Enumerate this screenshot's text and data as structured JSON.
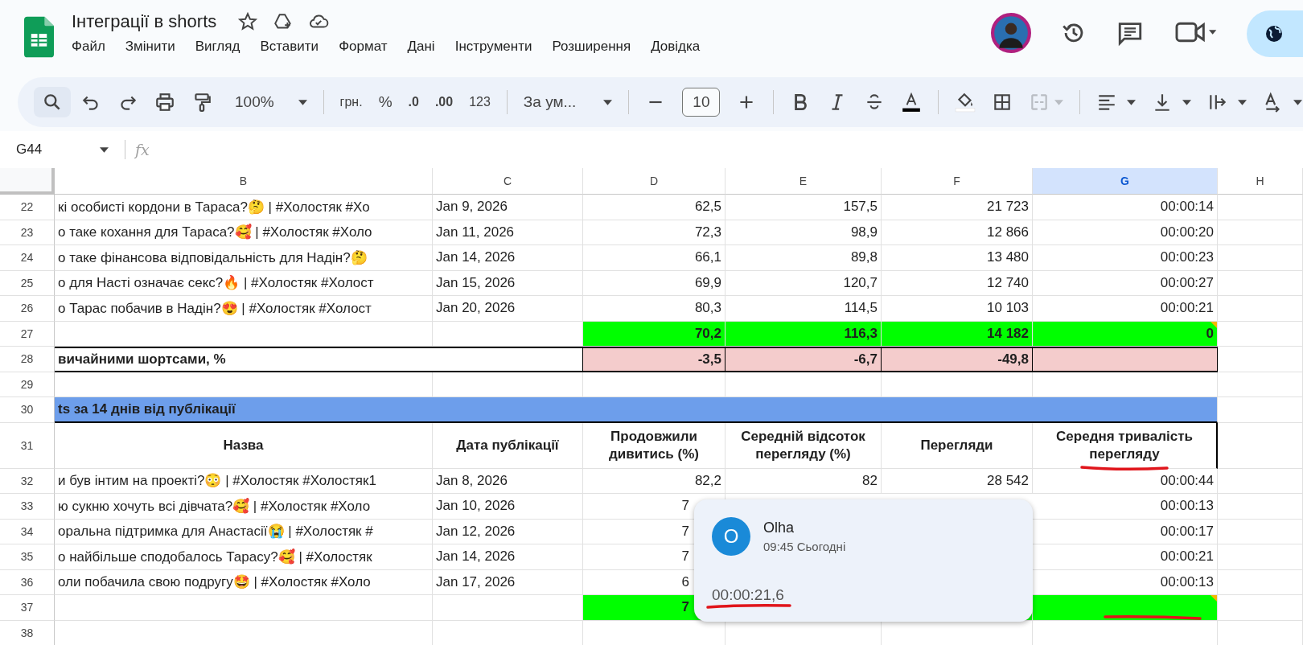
{
  "document": {
    "title": "Інтеграції в shorts"
  },
  "menu": [
    "Файл",
    "Змінити",
    "Вигляд",
    "Вставити",
    "Формат",
    "Дані",
    "Інструменти",
    "Розширення",
    "Довідка"
  ],
  "toolbar": {
    "zoom": "100%",
    "currency": "грн.",
    "percent": "%",
    "decrease_decimals": ".0",
    "increase_decimals": ".00",
    "number_format": "123",
    "font": "За ум...",
    "font_size": "10"
  },
  "name_box": "G44",
  "formula_label": "fx",
  "columns": [
    {
      "label": "B",
      "selected": false
    },
    {
      "label": "C",
      "selected": false
    },
    {
      "label": "D",
      "selected": false
    },
    {
      "label": "E",
      "selected": false
    },
    {
      "label": "F",
      "selected": false
    },
    {
      "label": "G",
      "selected": true
    },
    {
      "label": "H",
      "selected": false
    }
  ],
  "rows": [
    {
      "number": "22",
      "kind": "data",
      "covered": false,
      "title": "кі особисті кордони в Тараса?🤔 | #Холостяк #Хо",
      "date": "Jan 9, 2026",
      "values": [
        "62,5",
        "157,5",
        "21 723",
        "00:00:14"
      ]
    },
    {
      "number": "23",
      "kind": "data",
      "covered": false,
      "title": "о таке кохання для Тараса?🥰 | #Холостяк #Холо",
      "date": "Jan 11, 2026",
      "values": [
        "72,3",
        "98,9",
        "12 866",
        "00:00:20"
      ]
    },
    {
      "number": "24",
      "kind": "data",
      "covered": false,
      "title": "о таке фінансова відповідальність для Надін?🤔",
      "date": "Jan 14, 2026",
      "values": [
        "66,1",
        "89,8",
        "13 480",
        "00:00:23"
      ]
    },
    {
      "number": "25",
      "kind": "data",
      "covered": false,
      "title": "о для Насті означає секс?🔥 | #Холостяк #Холост",
      "date": "Jan 15, 2026",
      "values": [
        "69,9",
        "120,7",
        "12 740",
        "00:00:27"
      ]
    },
    {
      "number": "26",
      "kind": "data",
      "covered": false,
      "title": "о Тарас побачив в Надін?😍 | #Холостяк #Холост",
      "date": "Jan 20, 2026",
      "values": [
        "80,3",
        "114,5",
        "10 103",
        "00:00:21"
      ]
    },
    {
      "number": "27",
      "kind": "total",
      "covered": false,
      "note_marker": true,
      "values": [
        "70,2",
        "116,3",
        "14 182",
        "0"
      ]
    },
    {
      "number": "28",
      "kind": "difference",
      "label": "вичайними шортсами, %",
      "values": [
        "-3,5",
        "-6,7",
        "-49,8"
      ]
    },
    {
      "number": "29",
      "kind": "blank"
    },
    {
      "number": "30",
      "kind": "section",
      "label": "ts за 14 днів від публікації"
    },
    {
      "number": "31",
      "kind": "header",
      "headings": [
        "Назва",
        "Дата публікації",
        "Продовжили дивитись (%)",
        "Середній відсоток перегляду (%)",
        "Перегляди",
        "Середня тривалість перегляду"
      ]
    },
    {
      "number": "32",
      "kind": "data",
      "covered": false,
      "title": "и був інтим на проекті?😳 | #Холостяк #Холостяк1",
      "date": "Jan 8, 2026",
      "values": [
        "82,2",
        "82",
        "28 542",
        "00:00:44"
      ]
    },
    {
      "number": "33",
      "kind": "data",
      "covered": true,
      "title": "ю сукню хочуть всі дівчата?🥰 | #Холостяк #Холо",
      "date": "Jan 10, 2026",
      "values": [
        "7",
        "00:00:13"
      ]
    },
    {
      "number": "34",
      "kind": "data",
      "covered": true,
      "title": "оральна підтримка для Анастасії😭 | #Холостяк #",
      "date": "Jan 12, 2026",
      "values": [
        "7",
        "00:00:17"
      ]
    },
    {
      "number": "35",
      "kind": "data",
      "covered": true,
      "title": "о найбільше сподобалось Тарасу?🥰 | #Холостяк",
      "date": "Jan 14, 2026",
      "values": [
        "7",
        "00:00:21"
      ]
    },
    {
      "number": "36",
      "kind": "data",
      "covered": true,
      "title": "оли побачила свою подругу🤩 | #Холостяк #Холо",
      "date": "Jan 17, 2026",
      "values": [
        "6",
        "00:00:13"
      ]
    },
    {
      "number": "37",
      "kind": "total",
      "covered": true,
      "note_marker": true,
      "values": [
        "7"
      ]
    },
    {
      "number": "38",
      "kind": "blank"
    }
  ],
  "comment": {
    "author": "Olha",
    "initial": "O",
    "time": "09:45 Сьогодні",
    "text": "00:00:21,6"
  }
}
